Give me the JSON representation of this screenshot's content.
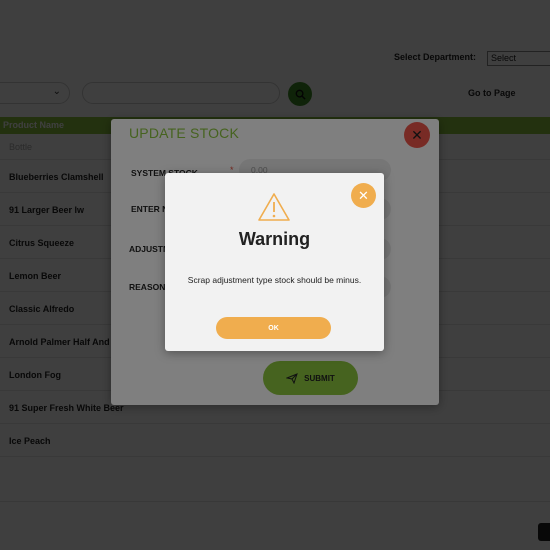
{
  "header": {
    "department_label": "Select Department:",
    "department_select_value": "Select",
    "goto_label": "Go to Page"
  },
  "table": {
    "column_header": "Product Name",
    "rows": [
      "Bottle",
      "Blueberries Clamshell",
      "91 Larger Beer lw",
      "Citrus Squeeze",
      "Lemon Beer",
      "Classic Alfredo",
      "Arnold Palmer Half And",
      "London Fog",
      "91 Super Fresh White Beer",
      "Ice Peach"
    ]
  },
  "stock_modal": {
    "title": "UPDATE STOCK",
    "labels": {
      "system_stock": "SYSTEM STOCK",
      "enter_new": "ENTER N",
      "adjustment": "ADJUSTM",
      "reason": "REASON"
    },
    "system_stock_value": "0.00",
    "submit_label": "SUBMIT"
  },
  "warning": {
    "title": "Warning",
    "message": "Scrap adjustment type stock should be minus.",
    "ok_label": "OK"
  },
  "colors": {
    "accent_green": "#8cc63f",
    "search_green": "#3f8f25",
    "warning_orange": "#f0ad4e",
    "close_red": "#f0574a"
  },
  "icons": {
    "search": "search-icon",
    "chevron": "chevron-down-icon",
    "close": "close-icon",
    "warning": "warning-triangle-icon",
    "send": "send-icon"
  }
}
